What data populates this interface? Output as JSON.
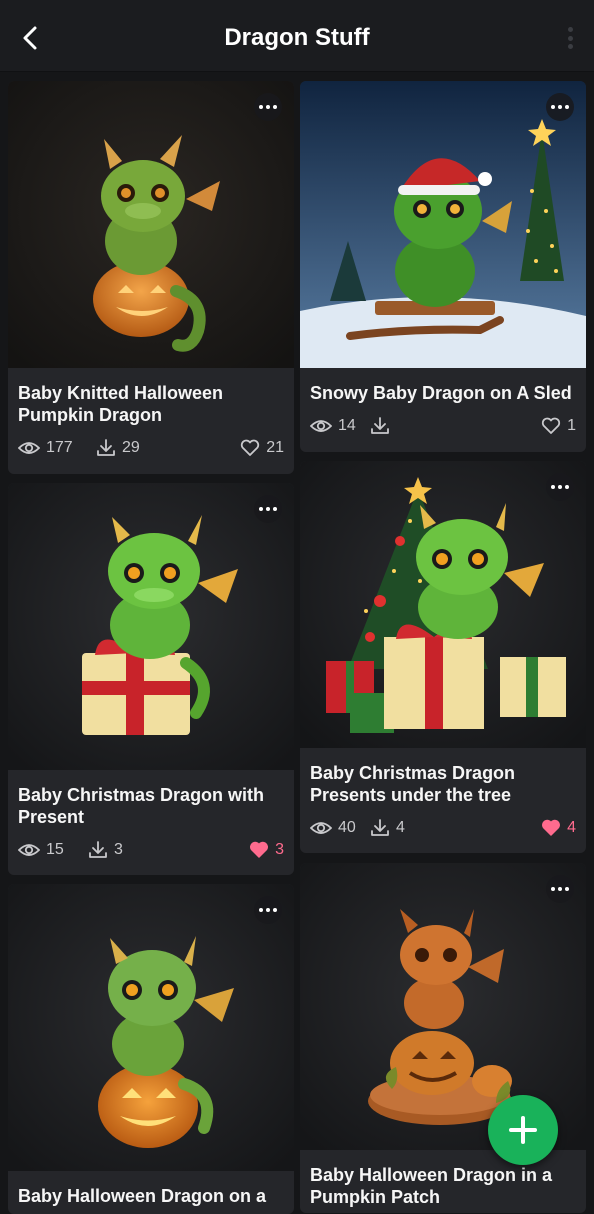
{
  "header": {
    "title": "Dragon Stuff",
    "back_icon": "chevron-left-icon",
    "menu_icon": "more-vertical-icon"
  },
  "cards": [
    {
      "title_line1": "Baby Knitted Halloween",
      "title_line2": "Pumpkin Dragon",
      "views": "177",
      "downloads": "29",
      "likes": "21",
      "liked": false
    },
    {
      "title_line1": "Snowy Baby Dragon on A Sled",
      "title_line2": "",
      "views": "14",
      "downloads": "",
      "likes": "1",
      "liked": false
    },
    {
      "title_line1": "Baby Christmas Dragon with",
      "title_line2": "Present",
      "views": "15",
      "downloads": "3",
      "likes": "3",
      "liked": true
    },
    {
      "title_line1": "Baby Christmas Dragon",
      "title_line2": "Presents under the tree",
      "views": "40",
      "downloads": "4",
      "likes": "4",
      "liked": true
    },
    {
      "title_line1": "Baby Halloween Dragon on a",
      "title_line2": "",
      "views": "",
      "downloads": "",
      "likes": "",
      "liked": false
    },
    {
      "title_line1": "Baby Halloween Dragon in a",
      "title_line2": "Pumpkin Patch",
      "views": "",
      "downloads": "",
      "likes": "",
      "liked": false
    }
  ],
  "colors": {
    "background": "#151618",
    "card": "#25262a",
    "accent_green": "#19b25a",
    "liked_pink": "#ff6b8e"
  },
  "fab": {
    "icon": "plus-icon"
  }
}
